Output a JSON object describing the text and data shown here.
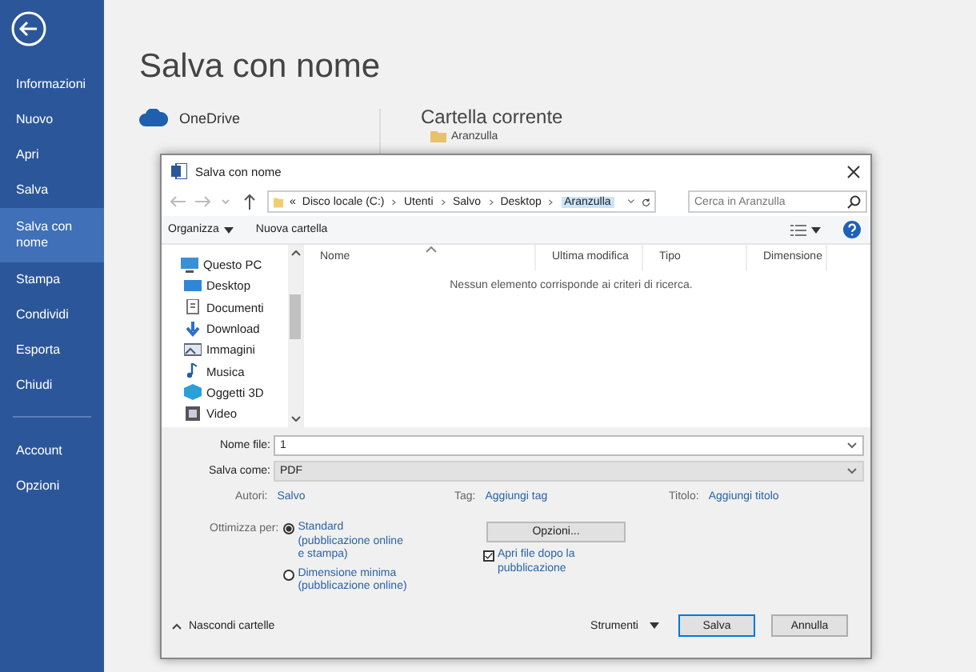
{
  "sidebar": {
    "items": [
      {
        "label": "Informazioni",
        "selected": false
      },
      {
        "label": "Nuovo",
        "selected": false
      },
      {
        "label": "Apri",
        "selected": false
      },
      {
        "label": "Salva",
        "selected": false
      },
      {
        "label": "Salva con nome",
        "selected": true
      },
      {
        "label": "Stampa",
        "selected": false
      },
      {
        "label": "Condividi",
        "selected": false
      },
      {
        "label": "Esporta",
        "selected": false
      },
      {
        "label": "Chiudi",
        "selected": false
      }
    ],
    "footer_items": [
      {
        "label": "Account",
        "selected": false
      },
      {
        "label": "Opzioni",
        "selected": false
      }
    ]
  },
  "backstage": {
    "title": "Salva con nome",
    "locations": [
      {
        "label": "OneDrive",
        "kind": "cloud"
      }
    ],
    "current_folder": {
      "heading": "Cartella corrente",
      "folder": "Aranzulla"
    }
  },
  "dialog": {
    "title": "Salva con nome",
    "address": [
      {
        "label": "«",
        "kind": "overflow",
        "selected": false
      },
      {
        "label": "Disco locale (C:)",
        "kind": "crumb",
        "selected": false
      },
      {
        "label": "Utenti",
        "kind": "crumb",
        "selected": false
      },
      {
        "label": "Salvo",
        "kind": "crumb",
        "selected": false
      },
      {
        "label": "Desktop",
        "kind": "crumb",
        "selected": false
      },
      {
        "label": "Aranzulla",
        "kind": "crumb",
        "selected": true
      }
    ],
    "search": {
      "placeholder": "Cerca in Aranzulla"
    },
    "toolbar": {
      "organize": "Organizza",
      "new_folder": "Nuova cartella"
    },
    "nav": [
      {
        "label": "Questo PC",
        "kind": "pc"
      },
      {
        "label": "Desktop",
        "kind": "desktop"
      },
      {
        "label": "Documenti",
        "kind": "documents"
      },
      {
        "label": "Download",
        "kind": "download"
      },
      {
        "label": "Immagini",
        "kind": "pictures"
      },
      {
        "label": "Musica",
        "kind": "music"
      },
      {
        "label": "Oggetti 3D",
        "kind": "objects"
      },
      {
        "label": "Video",
        "kind": "video"
      }
    ],
    "columns": [
      "Nome",
      "Ultima modifica",
      "Tipo",
      "Dimensione"
    ],
    "empty_message": "Nessun elemento corrisponde ai criteri di ricerca.",
    "filename": {
      "label": "Nome file:",
      "value": "1"
    },
    "save_as": {
      "label": "Salva come:",
      "value": "PDF"
    },
    "authors": {
      "label": "Autori:",
      "value": "Salvo"
    },
    "tags": {
      "label": "Tag:",
      "value": "Aggiungi tag"
    },
    "doc_title": {
      "label": "Titolo:",
      "value": "Aggiungi titolo"
    },
    "optimize": {
      "label": "Ottimizza per:",
      "options": [
        {
          "label": "Standard\n(pubblicazione online\ne stampa)",
          "selected": true
        },
        {
          "label": "Dimensione minima\n(pubblicazione online)",
          "selected": false
        }
      ]
    },
    "options_button": "Opzioni...",
    "open_after": {
      "label": "Apri file dopo la\npubblicazione",
      "checked": true
    },
    "hide_folders": "Nascondi cartelle",
    "tools": "Strumenti",
    "buttons": [
      {
        "label": "Salva",
        "kind": "primary"
      },
      {
        "label": "Annulla",
        "kind": "normal"
      }
    ]
  }
}
